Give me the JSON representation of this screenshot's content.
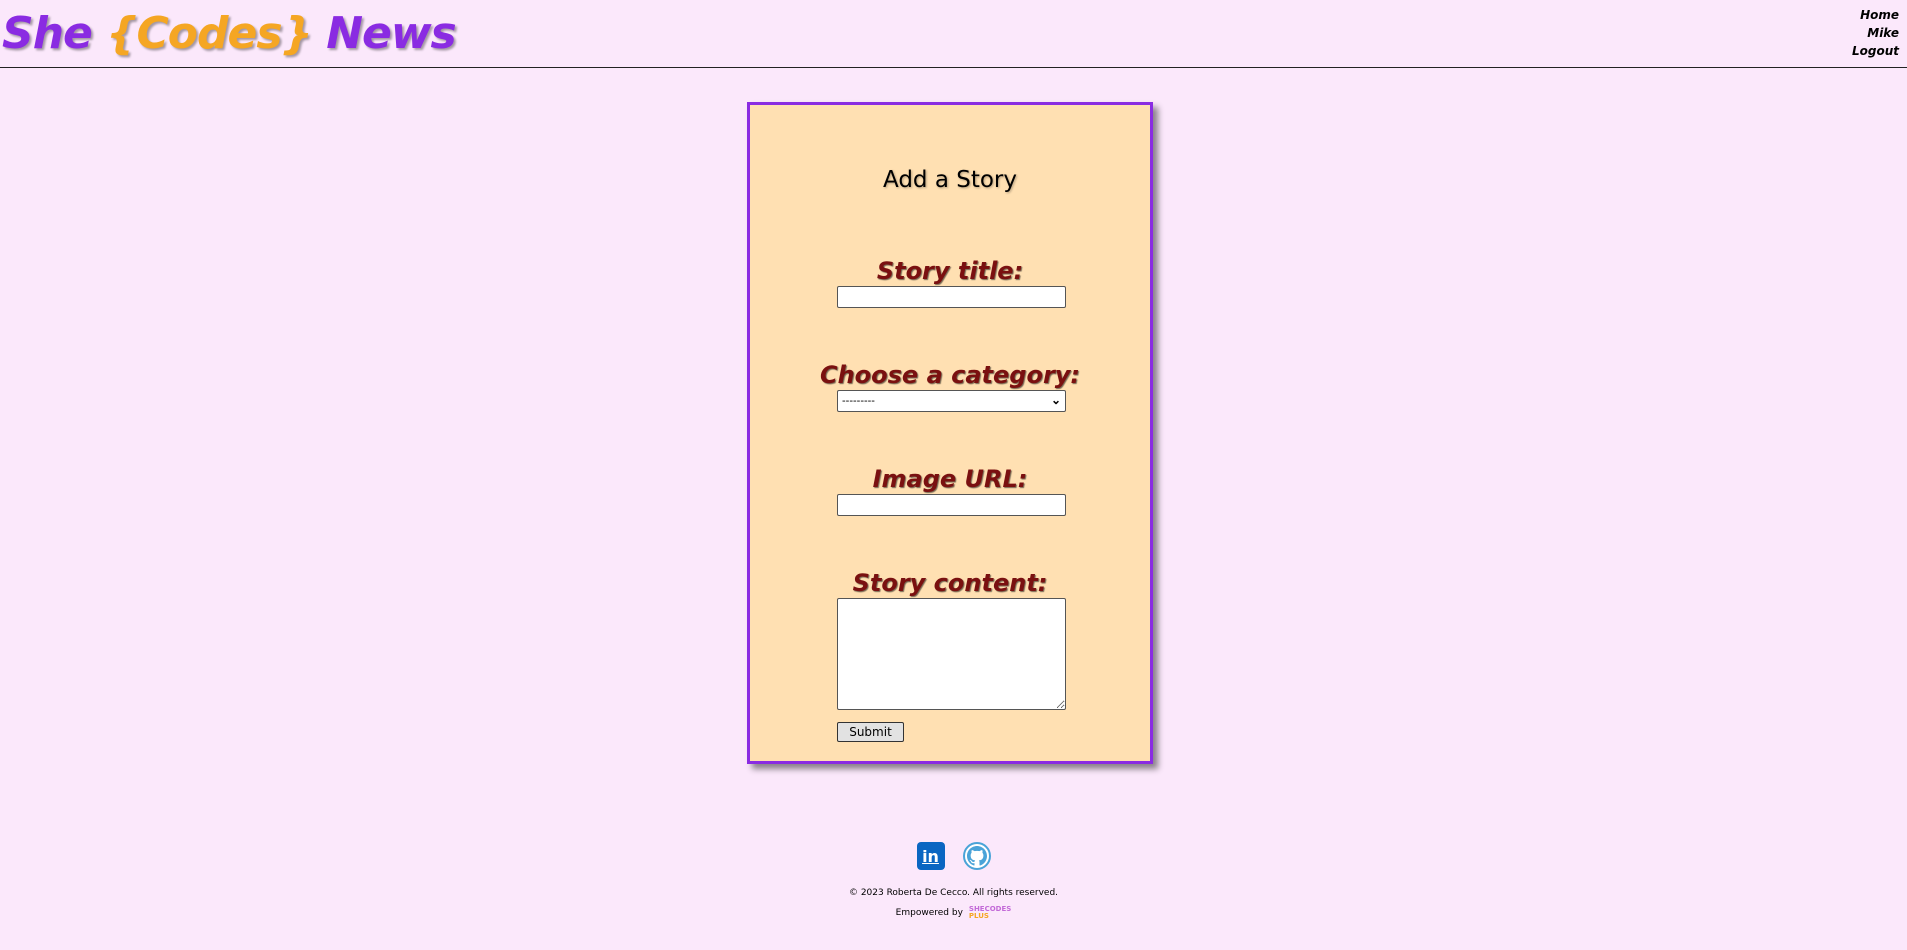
{
  "header": {
    "logo": {
      "part1": "She ",
      "part2": "{Codes}",
      "part3": " News"
    },
    "nav": [
      {
        "label": "Home"
      },
      {
        "label": "Mike"
      },
      {
        "label": "Logout"
      }
    ]
  },
  "form": {
    "title": "Add a Story",
    "fields": {
      "title_label": "Story title:",
      "title_value": "",
      "category_label": "Choose a category:",
      "category_selected": "---------",
      "image_label": "Image URL:",
      "image_value": "",
      "content_label": "Story content:",
      "content_value": ""
    },
    "submit_label": "Submit"
  },
  "footer": {
    "copyright": "© 2023 Roberta De Cecco. All rights reserved.",
    "powered_label": "Empowered by",
    "powered_logo": {
      "line1": "SHECODES",
      "line2": "PLUS"
    },
    "icons": [
      "linkedin-icon",
      "github-icon"
    ]
  },
  "colors": {
    "background": "#fbe8fb",
    "brand_purple": "#8a2be2",
    "brand_orange": "#f5a623",
    "card": "#ffe0b2",
    "label": "#7a1010"
  }
}
